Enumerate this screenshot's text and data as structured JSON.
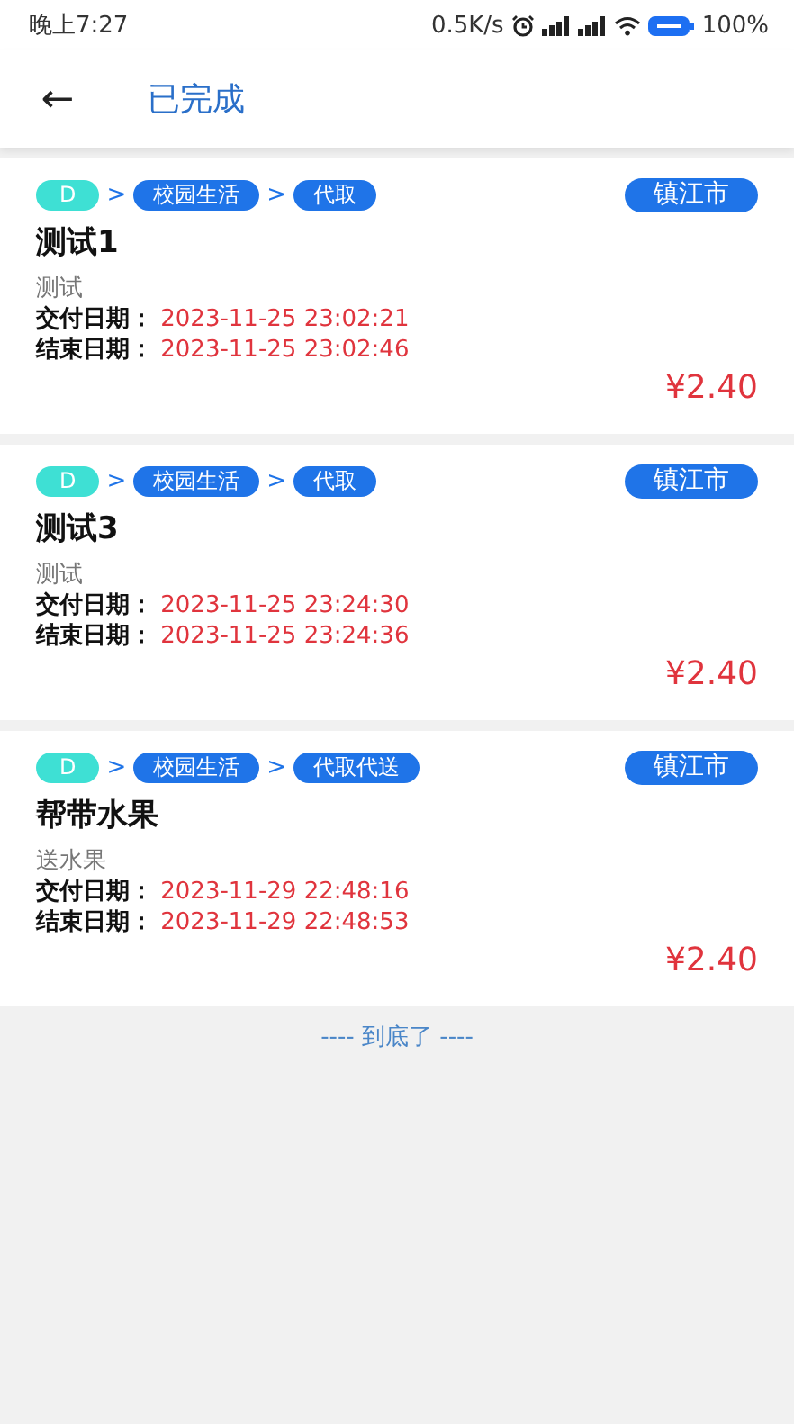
{
  "status_bar": {
    "time": "晚上7:27",
    "speed": "0.5K/s",
    "battery": "100%"
  },
  "header": {
    "back": "←",
    "title": "已完成"
  },
  "separator": ">",
  "orders": [
    {
      "path": [
        {
          "label": "D",
          "kind": "level"
        },
        {
          "label": "校园生活",
          "kind": "category"
        },
        {
          "label": "代取",
          "kind": "category"
        }
      ],
      "city": "镇江市",
      "title": "测试1",
      "desc": "测试",
      "dates": [
        {
          "label": "交付日期：",
          "value": "2023-11-25 23:02:21"
        },
        {
          "label": "结束日期：",
          "value": "2023-11-25 23:02:46"
        }
      ],
      "price": "¥2.40"
    },
    {
      "path": [
        {
          "label": "D",
          "kind": "level"
        },
        {
          "label": "校园生活",
          "kind": "category"
        },
        {
          "label": "代取",
          "kind": "category"
        }
      ],
      "city": "镇江市",
      "title": "测试3",
      "desc": "测试",
      "dates": [
        {
          "label": "交付日期：",
          "value": "2023-11-25 23:24:30"
        },
        {
          "label": "结束日期：",
          "value": "2023-11-25 23:24:36"
        }
      ],
      "price": "¥2.40"
    },
    {
      "path": [
        {
          "label": "D",
          "kind": "level"
        },
        {
          "label": "校园生活",
          "kind": "category"
        },
        {
          "label": "代取代送",
          "kind": "category"
        }
      ],
      "city": "镇江市",
      "title": "帮带水果",
      "desc": "送水果",
      "dates": [
        {
          "label": "交付日期：",
          "value": "2023-11-29 22:48:16"
        },
        {
          "label": "结束日期：",
          "value": "2023-11-29 22:48:53"
        }
      ],
      "price": "¥2.40"
    }
  ],
  "footer": "---- 到底了 ----"
}
